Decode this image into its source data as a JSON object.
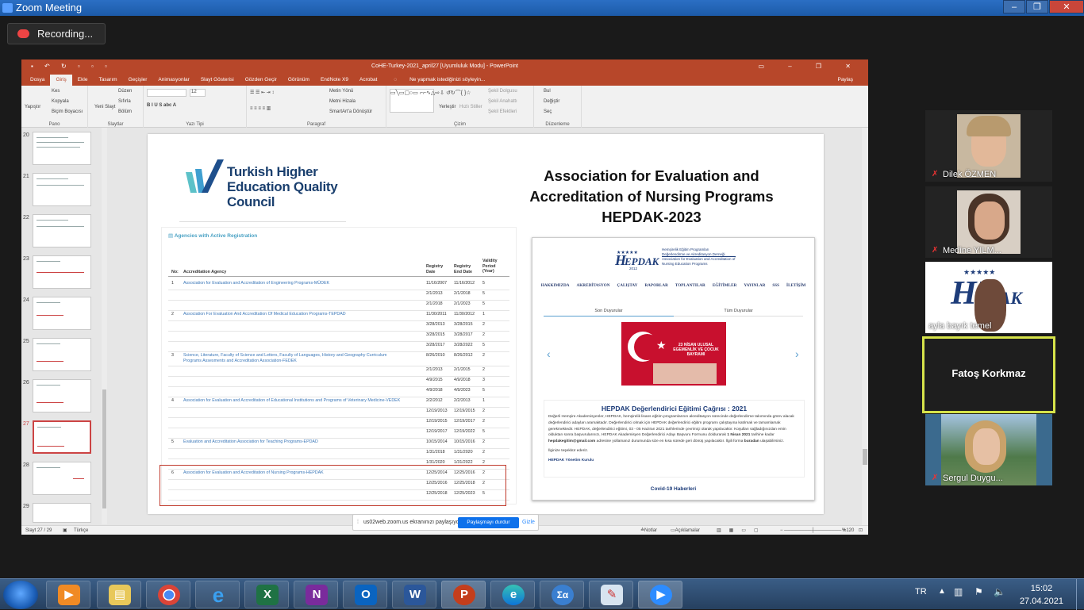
{
  "zoom": {
    "title": "Zoom Meeting",
    "recording": "Recording...",
    "window_buttons": [
      "‒",
      "❐",
      "✕"
    ]
  },
  "ppt": {
    "title": "CoHE-Turkey-2021_april27 [Uyumluluk Modu] - PowerPoint",
    "tabs": [
      "Dosya",
      "Giriş",
      "Ekle",
      "Tasarım",
      "Geçişler",
      "Animasyonlar",
      "Slayt Gösterisi",
      "Gözden Geçir",
      "Görünüm",
      "EndNote X9",
      "Acrobat"
    ],
    "tellme": "Ne yapmak istediğinizi söyleyin...",
    "share": "Paylaş",
    "ribbon": {
      "pano": {
        "label": "Pano",
        "paste": "Yapıştır",
        "cut": "Kes",
        "copy": "Kopyala",
        "painter": "Biçim Boyacısı"
      },
      "slaytlar": {
        "label": "Slaytlar",
        "new": "Yeni Slayt",
        "layout": "Düzen",
        "reset": "Sıfırla",
        "section": "Bölüm"
      },
      "yazi": {
        "label": "Yazı Tipi",
        "font_size": "12"
      },
      "paragraf": {
        "label": "Paragraf",
        "direction": "Metin Yönü",
        "align": "Metni Hizala",
        "smartart": "SmartArt'a Dönüştür"
      },
      "cizim": {
        "label": "Çizim",
        "arrange": "Yerleştir",
        "quick": "Hızlı Stiller",
        "fill": "Şekil Dolgusu",
        "outline": "Şekil Anahattı",
        "effects": "Şekil Efektleri"
      },
      "duzenleme": {
        "label": "Düzenleme",
        "find": "Bul",
        "replace": "Değiştir",
        "select": "Seç"
      }
    },
    "thumb_numbers": [
      "20",
      "21",
      "22",
      "23",
      "24",
      "25",
      "26",
      "27",
      "28",
      "29"
    ],
    "status": {
      "slide": "Slayt 27 / 29",
      "lang": "Türkçe",
      "notes": "Notlar",
      "comments": "Açıklamalar",
      "zoom": "%120"
    }
  },
  "slide": {
    "logo": "Turkish Higher Education Quality Council",
    "title_line1": "Association for Evaluation and",
    "title_line2": "Accreditation of Nursing Programs",
    "title_line3": "HEPDAK-2023",
    "agencies": {
      "heading": "Agencies with Active Registration",
      "headers": {
        "no": "No:",
        "agency": "Accreditation Agency",
        "reg": "Registry Date",
        "end": "Registry End Date",
        "val": "Validity Period (Year)"
      },
      "rows": [
        {
          "no": "1",
          "agency": "Association for Evaluation and Accreditation of Engineering Programs-MÜDEK",
          "reg": "11/16/2007",
          "end": "11/16/2012",
          "val": "5"
        },
        {
          "no": "",
          "agency": "",
          "reg": "2/1/2013",
          "end": "2/1/2018",
          "val": "5"
        },
        {
          "no": "",
          "agency": "",
          "reg": "2/1/2018",
          "end": "2/1/2023",
          "val": "5"
        },
        {
          "no": "2",
          "agency": "Association For Evaluation And Accreditation Of Medical Education Programs-TEPDAD",
          "reg": "11/30/2011",
          "end": "11/30/2012",
          "val": "1"
        },
        {
          "no": "",
          "agency": "",
          "reg": "3/28/2013",
          "end": "3/28/2015",
          "val": "2"
        },
        {
          "no": "",
          "agency": "",
          "reg": "3/28/2015",
          "end": "3/28/2017",
          "val": "2"
        },
        {
          "no": "",
          "agency": "",
          "reg": "3/28/2017",
          "end": "3/28/2022",
          "val": "5"
        },
        {
          "no": "3",
          "agency": "Science, Literature, Faculty of Science and Letters, Faculty of Languages, History and Geography Curriculum",
          "agency2": "Programs Assesments and Accreditation Association-FEDEK",
          "reg": "8/26/2010",
          "end": "8/26/2012",
          "val": "2"
        },
        {
          "no": "",
          "agency": "",
          "reg": "2/1/2013",
          "end": "2/1/2015",
          "val": "2"
        },
        {
          "no": "",
          "agency": "",
          "reg": "4/9/2015",
          "end": "4/9/2018",
          "val": "3"
        },
        {
          "no": "",
          "agency": "",
          "reg": "4/9/2018",
          "end": "4/9/2023",
          "val": "5"
        },
        {
          "no": "4",
          "agency": "Association for Evaluation and Accreditation of Educational Institutions and Programs of Veterinary Medicine-VEDEK",
          "reg": "2/2/2012",
          "end": "2/2/2013",
          "val": "1"
        },
        {
          "no": "",
          "agency": "",
          "reg": "12/19/2013",
          "end": "12/19/2015",
          "val": "2"
        },
        {
          "no": "",
          "agency": "",
          "reg": "12/19/2015",
          "end": "12/19/2017",
          "val": "2"
        },
        {
          "no": "",
          "agency": "",
          "reg": "12/19/2017",
          "end": "12/19/2022",
          "val": "5"
        },
        {
          "no": "5",
          "agency": "Evaluation and Accreditation Association for Teaching Programs-EPDAD",
          "reg": "10/15/2014",
          "end": "10/15/2016",
          "val": "2"
        },
        {
          "no": "",
          "agency": "",
          "reg": "1/31/2018",
          "end": "1/31/2020",
          "val": "2"
        },
        {
          "no": "",
          "agency": "",
          "reg": "1/31/2020",
          "end": "1/31/2022",
          "val": "2"
        },
        {
          "no": "6",
          "agency": "Association for Evaluation and Accreditation of Nursing Programs-HEPDAK",
          "reg": "12/25/2014",
          "end": "12/25/2016",
          "val": "2"
        },
        {
          "no": "",
          "agency": "",
          "reg": "12/25/2016",
          "end": "12/25/2018",
          "val": "2"
        },
        {
          "no": "",
          "agency": "",
          "reg": "12/25/2018",
          "end": "12/25/2023",
          "val": "5"
        }
      ]
    },
    "hepdak": {
      "brand": "HEPDAK",
      "year": "2012",
      "org_line1": "Hemşirelik Eğitim Programları",
      "org_line2": "Değerlendirme ve Akreditasyon Derneği",
      "org_line3": "Association for Evaluation and Accreditation of",
      "org_line4": "Nursing Education Programs",
      "nav": [
        "HAKKIMIZDA",
        "AKREDİTASYON",
        "ÇALIŞTAY",
        "RAPORLAR",
        "TOPLANTILAR",
        "EĞİTİMLER",
        "YAYINLAR",
        "SSS",
        "İLETİŞİM"
      ],
      "tab_active": "Son Duyurular",
      "tab_other": "Tüm Duyurular",
      "banner_text": "23 NİSAN ULUSAL EGEMENLİK VE ÇOCUK BAYRAMI",
      "announce_title": "HEPDAK Değerlendirici Eğitimi Çağrısı : 2021",
      "announce_body": "Değerli Hemşire Akademisyenler, HEPDAK, hemşirelik lisans eğitim programlarının akreditasyon sürecinde değerlendirme takımında görev alacak değerlendirici adayları aramaktadır. Değerlendirici olmak için HEPDAK değerlendirici eğitim programı çalıştayına katılmak ve tamamlamak gerekmektedir. HEPDAK, değerlendirici eğitimi, 03 - 05 Haziran 2021 tarihlerinde çevrimiçi olarak yapılacaktır. Koşulları sağladığınızdan emin olduktan sonra başvurularınızı, HEPDAK Akademisyen Değerlendirici Adayı Başvuru Formunu doldurarak",
      "announce_date": "1 Nisan 2021",
      "announce_mid": "tarihine kadar",
      "announce_email": "hepdakegitim@gmail.com",
      "announce_tail": "adresine yollamanız durumunda size en kısa sürede geri dönüş yapılacaktır. İlgili forma",
      "announce_link": "buradan",
      "announce_end": "ulaşabilirsiniz.",
      "thanks": "İlginize teşekkür ederiz.",
      "sign": "HEPDAK Yönetim Kurulu",
      "covid": "Covid-19 Haberleri"
    }
  },
  "share_bar": {
    "text": "us02web.zoom.us ekranınızı paylaşıyor.",
    "stop": "Paylaşmayı durdur",
    "hide": "Gizle"
  },
  "participants": [
    {
      "name": "Dilek ÖZMEN"
    },
    {
      "name": "Medine YILM..."
    },
    {
      "name": "ayla bayık temel"
    },
    {
      "name": "Fatoş Korkmaz"
    },
    {
      "name": "Sergul Duygu..."
    }
  ],
  "taskbar": {
    "lang": "TR",
    "time": "15:02",
    "date": "27.04.2021"
  },
  "colors": {
    "ppt_accent": "#b7472a",
    "zoom_blue": "#0e71eb",
    "speaker_border": "#d6e34a"
  }
}
